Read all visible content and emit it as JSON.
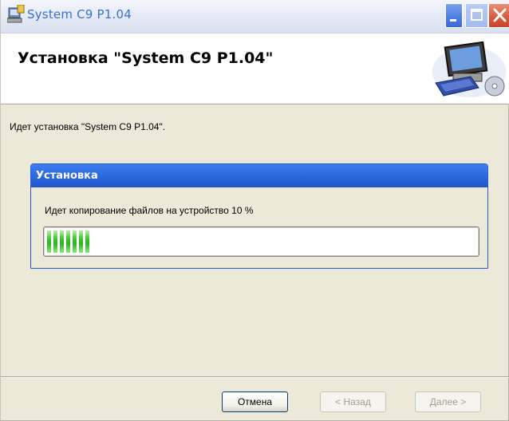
{
  "window": {
    "title": "System C9 P1.04",
    "controls": {
      "minimize": "minimize",
      "maximize": "maximize",
      "close": "close"
    }
  },
  "header": {
    "title": "Установка \"System C9 P1.04\"",
    "icon": "computer-setup-icon"
  },
  "status": {
    "text": "Идет установка \"System C9 P1.04\"."
  },
  "group": {
    "title": "Установка",
    "message": "Идет копирование файлов на устройство 10 %",
    "progress_percent": 10
  },
  "buttons": {
    "cancel": "Отмена",
    "back": "< Назад",
    "next": "Далее >"
  },
  "colors": {
    "title_text": "#3a6fd8",
    "group_header": "#2d69e0",
    "progress_fill": "#35c526"
  }
}
